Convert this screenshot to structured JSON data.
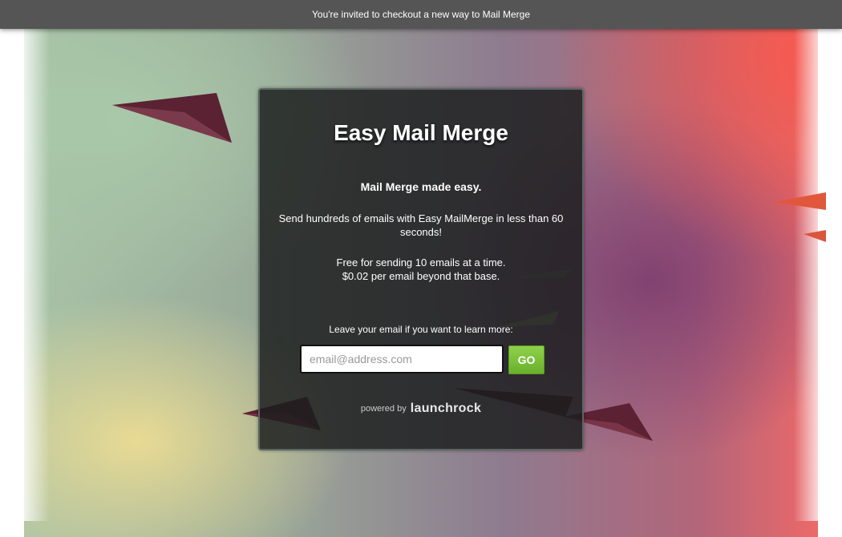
{
  "banner": {
    "text": "You're invited to checkout a new way to Mail Merge"
  },
  "card": {
    "title": "Easy Mail Merge",
    "tagline": "Mail Merge made easy.",
    "description": "Send hundreds of emails with Easy MailMerge in less than 60 seconds!",
    "pricing_line1": "Free for sending 10 emails at a time.",
    "pricing_line2": "$0.02 per email beyond that base.",
    "signup_prompt": "Leave your email if you want to learn more:",
    "email_placeholder": "email@address.com",
    "email_value": "",
    "go_label": "GO",
    "powered_by_label": "powered by",
    "powered_by_brand": "launchrock"
  },
  "colors": {
    "banner_bg": "#555555",
    "card_bg": "#1c1e1e",
    "card_border": "#5b6664",
    "go_button": "#7cc23a",
    "plane": "#6b2a3c"
  }
}
